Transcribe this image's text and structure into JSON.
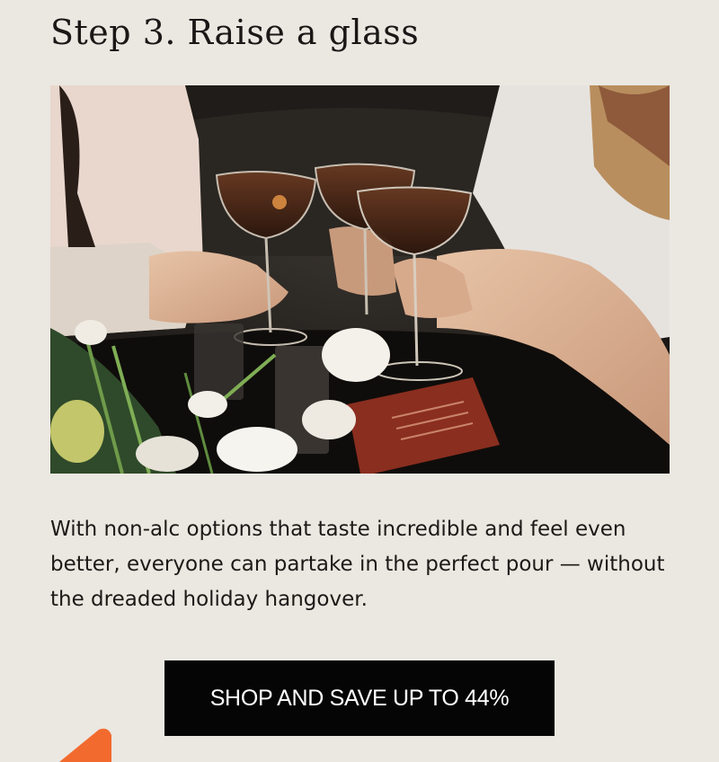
{
  "step": {
    "title": "Step 3. Raise a glass"
  },
  "photo": {
    "alt": ""
  },
  "body": {
    "text": "With non-alc options that taste incredible and feel even better, everyone can partake in the perfect pour — without the dreaded holiday hangover."
  },
  "cta": {
    "label": "SHOP AND SAVE UP TO 44%"
  },
  "colors": {
    "background": "#ebe7e1",
    "button": "#050505",
    "accent": "#f26a2e"
  }
}
